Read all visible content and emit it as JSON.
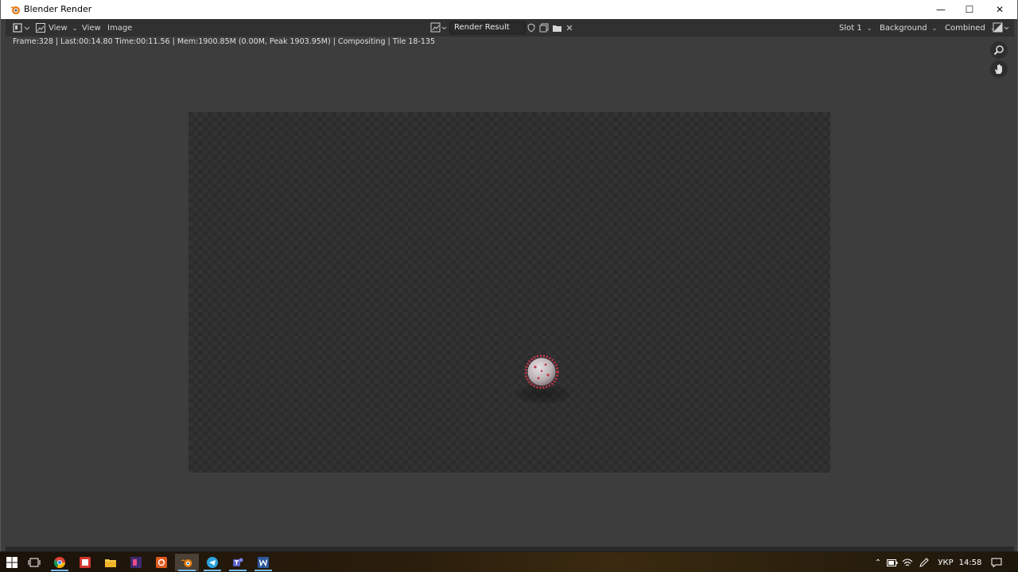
{
  "window": {
    "title": "Blender Render",
    "controls": {
      "minimize": "—",
      "maximize": "☐",
      "close": "✕"
    }
  },
  "header": {
    "view_menu_1": "View",
    "view_menu_2": "View",
    "image_menu": "Image",
    "image_name": "Render Result",
    "slot": "Slot 1",
    "layer": "Background",
    "pass": "Combined"
  },
  "stats_text": "Frame:328 | Last:00:14.80 Time:00:11.56 | Mem:1900.85M (0.00M, Peak 1903.95M) | Compositing | Tile 18-135",
  "taskbar": {
    "apps": [
      "windows-start-icon",
      "task-view-icon",
      "chrome-icon",
      "app-red-icon",
      "file-explorer-icon",
      "app-purple-icon",
      "app-orange-icon",
      "blender-icon",
      "telegram-icon",
      "teams-icon",
      "word-icon"
    ],
    "language": "УКР",
    "time": "14:58"
  },
  "colors": {
    "blender_bg": "#3d3d3d",
    "header_bg": "#303030",
    "accent_blue": "#76b9ed",
    "virus_red": "#c4364a"
  }
}
